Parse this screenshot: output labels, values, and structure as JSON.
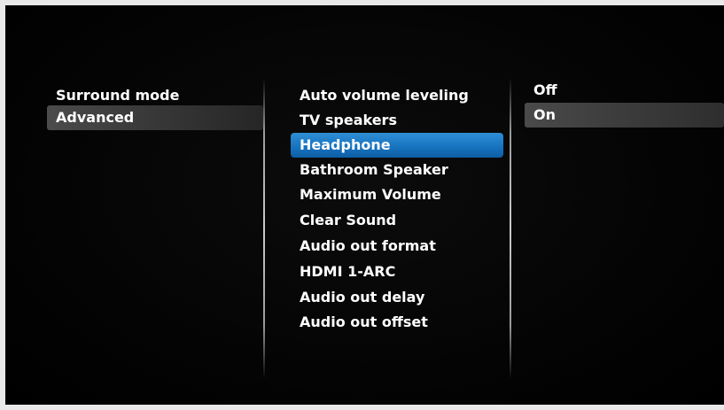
{
  "left_menu": {
    "items": [
      {
        "label": "Surround mode"
      },
      {
        "label": "Advanced"
      }
    ],
    "selected_index": 1
  },
  "middle_menu": {
    "items": [
      {
        "label": "Auto volume leveling"
      },
      {
        "label": "TV speakers"
      },
      {
        "label": "Headphone"
      },
      {
        "label": "Bathroom Speaker"
      },
      {
        "label": "Maximum Volume"
      },
      {
        "label": "Clear Sound"
      },
      {
        "label": "Audio out format"
      },
      {
        "label": "HDMI 1-ARC"
      },
      {
        "label": "Audio out delay"
      },
      {
        "label": "Audio out offset"
      }
    ],
    "focused_index": 2
  },
  "right_menu": {
    "options": [
      {
        "label": "Off"
      },
      {
        "label": "On"
      }
    ],
    "selected_index": 1
  },
  "colors": {
    "background": "#000000",
    "text": "#ffffff",
    "focus_highlight": "#1a78c2",
    "selection_highlight": "#404040"
  }
}
